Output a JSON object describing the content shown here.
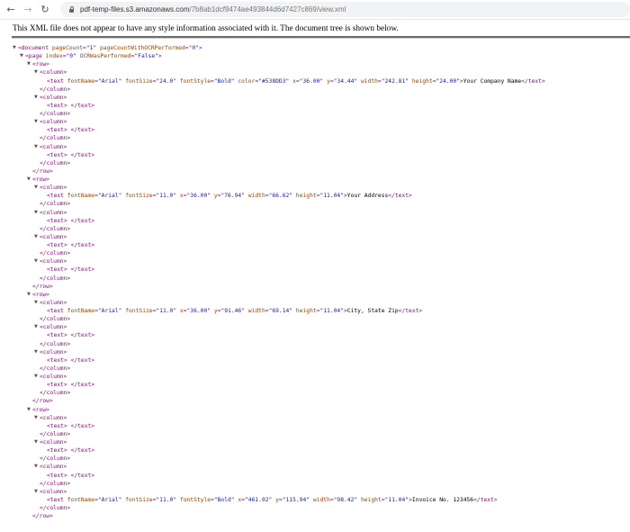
{
  "browser": {
    "back_icon": "arrow-left",
    "forward_icon": "arrow-right",
    "reload_icon": "reload",
    "url_host": "pdf-temp-files.s3.amazonaws.com",
    "url_path": "/7b8ab1dcf9474ae493844d6d7427c869/view.xml"
  },
  "info_message": "This XML file does not appear to have any style information associated with it. The document tree is shown below.",
  "colors": {
    "tag": "#881280",
    "attr_name": "#994500",
    "attr_value": "#1a1aa6"
  },
  "tree": [
    {
      "i": 0,
      "a": true,
      "s": [
        [
          "tag",
          "<document "
        ],
        [
          "an",
          "pageCount"
        ],
        [
          "tag",
          "="
        ],
        [
          "av",
          "\"1\""
        ],
        [
          "tag",
          " "
        ],
        [
          "an",
          "pageCountWithOCRPerformed"
        ],
        [
          "tag",
          "="
        ],
        [
          "av",
          "\"0\""
        ],
        [
          "tag",
          ">"
        ]
      ]
    },
    {
      "i": 1,
      "a": true,
      "s": [
        [
          "tag",
          "<page "
        ],
        [
          "an",
          "index"
        ],
        [
          "tag",
          "="
        ],
        [
          "av",
          "\"0\""
        ],
        [
          "tag",
          " "
        ],
        [
          "an",
          "OCRWasPerformed"
        ],
        [
          "tag",
          "="
        ],
        [
          "av",
          "\"False\""
        ],
        [
          "tag",
          ">"
        ]
      ]
    },
    {
      "i": 2,
      "a": true,
      "s": [
        [
          "tag",
          "<row>"
        ]
      ]
    },
    {
      "i": 3,
      "a": true,
      "s": [
        [
          "tag",
          "<column>"
        ]
      ]
    },
    {
      "i": 4,
      "a": false,
      "s": [
        [
          "tag",
          "<text "
        ],
        [
          "an",
          "fontName"
        ],
        [
          "tag",
          "="
        ],
        [
          "av",
          "\"Arial\""
        ],
        [
          "tag",
          " "
        ],
        [
          "an",
          "fontSize"
        ],
        [
          "tag",
          "="
        ],
        [
          "av",
          "\"24.0\""
        ],
        [
          "tag",
          " "
        ],
        [
          "an",
          "fontStyle"
        ],
        [
          "tag",
          "="
        ],
        [
          "av",
          "\"Bold\""
        ],
        [
          "tag",
          " "
        ],
        [
          "an",
          "color"
        ],
        [
          "tag",
          "="
        ],
        [
          "av",
          "\"#538DD3\""
        ],
        [
          "tag",
          " "
        ],
        [
          "an",
          "x"
        ],
        [
          "tag",
          "="
        ],
        [
          "av",
          "\"36.00\""
        ],
        [
          "tag",
          " "
        ],
        [
          "an",
          "y"
        ],
        [
          "tag",
          "="
        ],
        [
          "av",
          "\"34.44\""
        ],
        [
          "tag",
          " "
        ],
        [
          "an",
          "width"
        ],
        [
          "tag",
          "="
        ],
        [
          "av",
          "\"242.81\""
        ],
        [
          "tag",
          " "
        ],
        [
          "an",
          "height"
        ],
        [
          "tag",
          "="
        ],
        [
          "av",
          "\"24.00\""
        ],
        [
          "tag",
          ">"
        ],
        [
          "tx",
          "Your Company Name"
        ],
        [
          "tag",
          "</text>"
        ]
      ]
    },
    {
      "i": 3,
      "a": false,
      "s": [
        [
          "tag",
          "</column>"
        ]
      ]
    },
    {
      "i": 3,
      "a": true,
      "s": [
        [
          "tag",
          "<column>"
        ]
      ]
    },
    {
      "i": 4,
      "a": false,
      "s": [
        [
          "tag",
          "<text>"
        ],
        [
          "tx",
          " "
        ],
        [
          "tag",
          "</text>"
        ]
      ]
    },
    {
      "i": 3,
      "a": false,
      "s": [
        [
          "tag",
          "</column>"
        ]
      ]
    },
    {
      "i": 3,
      "a": true,
      "s": [
        [
          "tag",
          "<column>"
        ]
      ]
    },
    {
      "i": 4,
      "a": false,
      "s": [
        [
          "tag",
          "<text>"
        ],
        [
          "tx",
          " "
        ],
        [
          "tag",
          "</text>"
        ]
      ]
    },
    {
      "i": 3,
      "a": false,
      "s": [
        [
          "tag",
          "</column>"
        ]
      ]
    },
    {
      "i": 3,
      "a": true,
      "s": [
        [
          "tag",
          "<column>"
        ]
      ]
    },
    {
      "i": 4,
      "a": false,
      "s": [
        [
          "tag",
          "<text>"
        ],
        [
          "tx",
          " "
        ],
        [
          "tag",
          "</text>"
        ]
      ]
    },
    {
      "i": 3,
      "a": false,
      "s": [
        [
          "tag",
          "</column>"
        ]
      ]
    },
    {
      "i": 2,
      "a": false,
      "s": [
        [
          "tag",
          "</row>"
        ]
      ]
    },
    {
      "i": 2,
      "a": true,
      "s": [
        [
          "tag",
          "<row>"
        ]
      ]
    },
    {
      "i": 3,
      "a": true,
      "s": [
        [
          "tag",
          "<column>"
        ]
      ]
    },
    {
      "i": 4,
      "a": false,
      "s": [
        [
          "tag",
          "<text "
        ],
        [
          "an",
          "fontName"
        ],
        [
          "tag",
          "="
        ],
        [
          "av",
          "\"Arial\""
        ],
        [
          "tag",
          " "
        ],
        [
          "an",
          "fontSize"
        ],
        [
          "tag",
          "="
        ],
        [
          "av",
          "\"11.0\""
        ],
        [
          "tag",
          " "
        ],
        [
          "an",
          "x"
        ],
        [
          "tag",
          "="
        ],
        [
          "av",
          "\"36.00\""
        ],
        [
          "tag",
          " "
        ],
        [
          "an",
          "y"
        ],
        [
          "tag",
          "="
        ],
        [
          "av",
          "\"76.94\""
        ],
        [
          "tag",
          " "
        ],
        [
          "an",
          "width"
        ],
        [
          "tag",
          "="
        ],
        [
          "av",
          "\"66.62\""
        ],
        [
          "tag",
          " "
        ],
        [
          "an",
          "height"
        ],
        [
          "tag",
          "="
        ],
        [
          "av",
          "\"11.04\""
        ],
        [
          "tag",
          ">"
        ],
        [
          "tx",
          "Your Address"
        ],
        [
          "tag",
          "</text>"
        ]
      ]
    },
    {
      "i": 3,
      "a": false,
      "s": [
        [
          "tag",
          "</column>"
        ]
      ]
    },
    {
      "i": 3,
      "a": true,
      "s": [
        [
          "tag",
          "<column>"
        ]
      ]
    },
    {
      "i": 4,
      "a": false,
      "s": [
        [
          "tag",
          "<text>"
        ],
        [
          "tx",
          " "
        ],
        [
          "tag",
          "</text>"
        ]
      ]
    },
    {
      "i": 3,
      "a": false,
      "s": [
        [
          "tag",
          "</column>"
        ]
      ]
    },
    {
      "i": 3,
      "a": true,
      "s": [
        [
          "tag",
          "<column>"
        ]
      ]
    },
    {
      "i": 4,
      "a": false,
      "s": [
        [
          "tag",
          "<text>"
        ],
        [
          "tx",
          " "
        ],
        [
          "tag",
          "</text>"
        ]
      ]
    },
    {
      "i": 3,
      "a": false,
      "s": [
        [
          "tag",
          "</column>"
        ]
      ]
    },
    {
      "i": 3,
      "a": true,
      "s": [
        [
          "tag",
          "<column>"
        ]
      ]
    },
    {
      "i": 4,
      "a": false,
      "s": [
        [
          "tag",
          "<text>"
        ],
        [
          "tx",
          " "
        ],
        [
          "tag",
          "</text>"
        ]
      ]
    },
    {
      "i": 3,
      "a": false,
      "s": [
        [
          "tag",
          "</column>"
        ]
      ]
    },
    {
      "i": 2,
      "a": false,
      "s": [
        [
          "tag",
          "</row>"
        ]
      ]
    },
    {
      "i": 2,
      "a": true,
      "s": [
        [
          "tag",
          "<row>"
        ]
      ]
    },
    {
      "i": 3,
      "a": true,
      "s": [
        [
          "tag",
          "<column>"
        ]
      ]
    },
    {
      "i": 4,
      "a": false,
      "s": [
        [
          "tag",
          "<text "
        ],
        [
          "an",
          "fontName"
        ],
        [
          "tag",
          "="
        ],
        [
          "av",
          "\"Arial\""
        ],
        [
          "tag",
          " "
        ],
        [
          "an",
          "fontSize"
        ],
        [
          "tag",
          "="
        ],
        [
          "av",
          "\"11.0\""
        ],
        [
          "tag",
          " "
        ],
        [
          "an",
          "x"
        ],
        [
          "tag",
          "="
        ],
        [
          "av",
          "\"36.00\""
        ],
        [
          "tag",
          " "
        ],
        [
          "an",
          "y"
        ],
        [
          "tag",
          "="
        ],
        [
          "av",
          "\"91.46\""
        ],
        [
          "tag",
          " "
        ],
        [
          "an",
          "width"
        ],
        [
          "tag",
          "="
        ],
        [
          "av",
          "\"69.14\""
        ],
        [
          "tag",
          " "
        ],
        [
          "an",
          "height"
        ],
        [
          "tag",
          "="
        ],
        [
          "av",
          "\"11.04\""
        ],
        [
          "tag",
          ">"
        ],
        [
          "tx",
          "City, State Zip"
        ],
        [
          "tag",
          "</text>"
        ]
      ]
    },
    {
      "i": 3,
      "a": false,
      "s": [
        [
          "tag",
          "</column>"
        ]
      ]
    },
    {
      "i": 3,
      "a": true,
      "s": [
        [
          "tag",
          "<column>"
        ]
      ]
    },
    {
      "i": 4,
      "a": false,
      "s": [
        [
          "tag",
          "<text>"
        ],
        [
          "tx",
          " "
        ],
        [
          "tag",
          "</text>"
        ]
      ]
    },
    {
      "i": 3,
      "a": false,
      "s": [
        [
          "tag",
          "</column>"
        ]
      ]
    },
    {
      "i": 3,
      "a": true,
      "s": [
        [
          "tag",
          "<column>"
        ]
      ]
    },
    {
      "i": 4,
      "a": false,
      "s": [
        [
          "tag",
          "<text>"
        ],
        [
          "tx",
          " "
        ],
        [
          "tag",
          "</text>"
        ]
      ]
    },
    {
      "i": 3,
      "a": false,
      "s": [
        [
          "tag",
          "</column>"
        ]
      ]
    },
    {
      "i": 3,
      "a": true,
      "s": [
        [
          "tag",
          "<column>"
        ]
      ]
    },
    {
      "i": 4,
      "a": false,
      "s": [
        [
          "tag",
          "<text>"
        ],
        [
          "tx",
          " "
        ],
        [
          "tag",
          "</text>"
        ]
      ]
    },
    {
      "i": 3,
      "a": false,
      "s": [
        [
          "tag",
          "</column>"
        ]
      ]
    },
    {
      "i": 2,
      "a": false,
      "s": [
        [
          "tag",
          "</row>"
        ]
      ]
    },
    {
      "i": 2,
      "a": true,
      "s": [
        [
          "tag",
          "<row>"
        ]
      ]
    },
    {
      "i": 3,
      "a": true,
      "s": [
        [
          "tag",
          "<column>"
        ]
      ]
    },
    {
      "i": 4,
      "a": false,
      "s": [
        [
          "tag",
          "<text>"
        ],
        [
          "tx",
          " "
        ],
        [
          "tag",
          "</text>"
        ]
      ]
    },
    {
      "i": 3,
      "a": false,
      "s": [
        [
          "tag",
          "</column>"
        ]
      ]
    },
    {
      "i": 3,
      "a": true,
      "s": [
        [
          "tag",
          "<column>"
        ]
      ]
    },
    {
      "i": 4,
      "a": false,
      "s": [
        [
          "tag",
          "<text>"
        ],
        [
          "tx",
          " "
        ],
        [
          "tag",
          "</text>"
        ]
      ]
    },
    {
      "i": 3,
      "a": false,
      "s": [
        [
          "tag",
          "</column>"
        ]
      ]
    },
    {
      "i": 3,
      "a": true,
      "s": [
        [
          "tag",
          "<column>"
        ]
      ]
    },
    {
      "i": 4,
      "a": false,
      "s": [
        [
          "tag",
          "<text>"
        ],
        [
          "tx",
          " "
        ],
        [
          "tag",
          "</text>"
        ]
      ]
    },
    {
      "i": 3,
      "a": false,
      "s": [
        [
          "tag",
          "</column>"
        ]
      ]
    },
    {
      "i": 3,
      "a": true,
      "s": [
        [
          "tag",
          "<column>"
        ]
      ]
    },
    {
      "i": 4,
      "a": false,
      "s": [
        [
          "tag",
          "<text "
        ],
        [
          "an",
          "fontName"
        ],
        [
          "tag",
          "="
        ],
        [
          "av",
          "\"Arial\""
        ],
        [
          "tag",
          " "
        ],
        [
          "an",
          "fontSize"
        ],
        [
          "tag",
          "="
        ],
        [
          "av",
          "\"11.0\""
        ],
        [
          "tag",
          " "
        ],
        [
          "an",
          "fontStyle"
        ],
        [
          "tag",
          "="
        ],
        [
          "av",
          "\"Bold\""
        ],
        [
          "tag",
          " "
        ],
        [
          "an",
          "x"
        ],
        [
          "tag",
          "="
        ],
        [
          "av",
          "\"461.02\""
        ],
        [
          "tag",
          " "
        ],
        [
          "an",
          "y"
        ],
        [
          "tag",
          "="
        ],
        [
          "av",
          "\"115.94\""
        ],
        [
          "tag",
          " "
        ],
        [
          "an",
          "width"
        ],
        [
          "tag",
          "="
        ],
        [
          "av",
          "\"98.42\""
        ],
        [
          "tag",
          " "
        ],
        [
          "an",
          "height"
        ],
        [
          "tag",
          "="
        ],
        [
          "av",
          "\"11.04\""
        ],
        [
          "tag",
          ">"
        ],
        [
          "tx",
          "Invoice No. 123456"
        ],
        [
          "tag",
          "</text>"
        ]
      ]
    },
    {
      "i": 3,
      "a": false,
      "s": [
        [
          "tag",
          "</column>"
        ]
      ]
    },
    {
      "i": 2,
      "a": false,
      "s": [
        [
          "tag",
          "</row>"
        ]
      ]
    }
  ]
}
